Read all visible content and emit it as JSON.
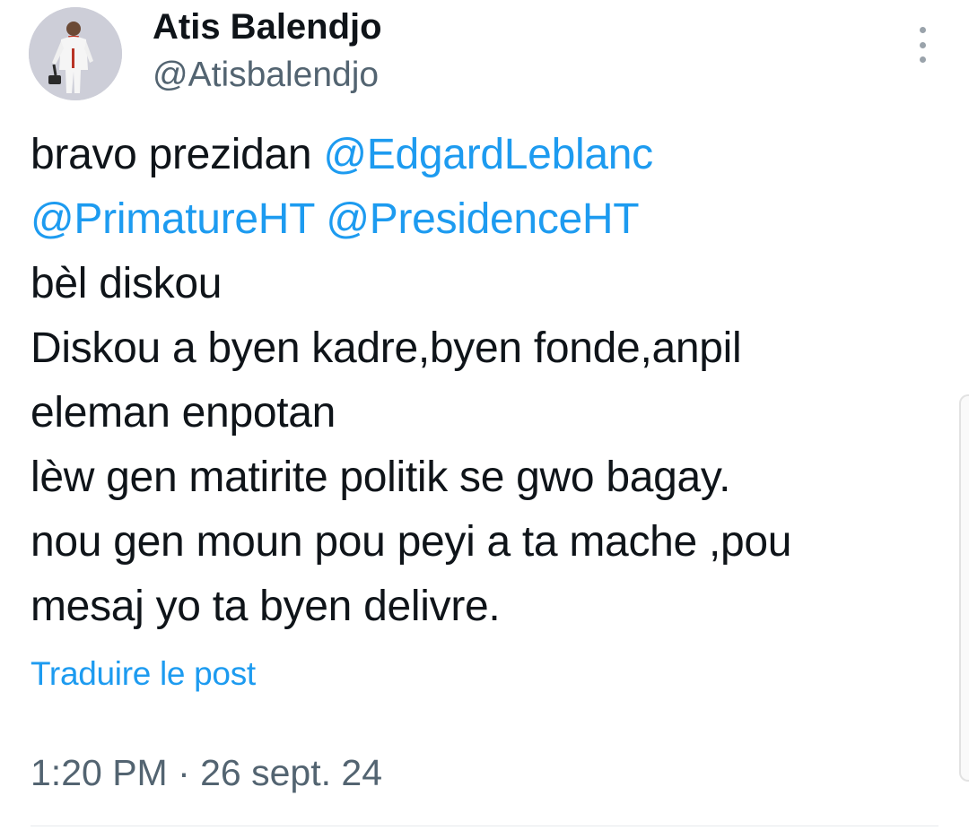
{
  "author": {
    "display_name": "Atis Balendjo",
    "handle": "@Atisbalendjo"
  },
  "tweet": {
    "line1_text": "bravo prezidan ",
    "mention_1": "@EdgardLeblanc",
    "mention_2": "@PrimatureHT",
    "line2_space": " ",
    "mention_3": "@PresidenceHT",
    "line3": "bèl diskou",
    "line4": "Diskou a byen kadre,byen fonde,anpil",
    "line5": "eleman enpotan",
    "line6": "lèw gen matirite politik se gwo bagay.",
    "line7": "nou gen moun pou peyi a ta mache ,pou",
    "line8": "mesaj yo ta byen delivre."
  },
  "translate_label": "Traduire le post",
  "timestamp": "1:20 PM · 26 sept. 24",
  "icons": {
    "more": "more-vertical-icon",
    "avatar": "profile-avatar"
  },
  "colors": {
    "text": "#0f1419",
    "secondary": "#536471",
    "link": "#1d9bf0"
  }
}
